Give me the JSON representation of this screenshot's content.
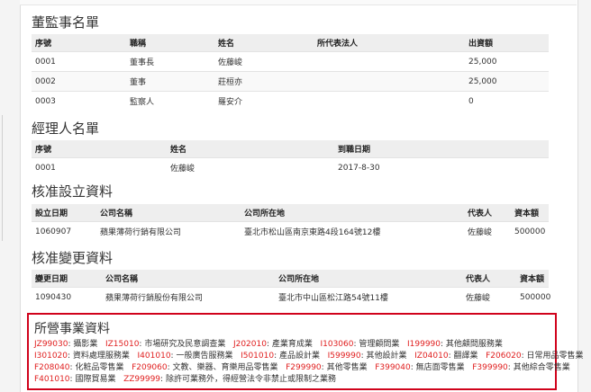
{
  "directors": {
    "title": "董監事名單",
    "headers": [
      "序號",
      "職稱",
      "姓名",
      "所代表法人",
      "出資額"
    ],
    "rows": [
      [
        "0001",
        "董事長",
        "佐藤峻",
        "",
        "25,000"
      ],
      [
        "0002",
        "董事",
        "莊桓亦",
        "",
        "25,000"
      ],
      [
        "0003",
        "監察人",
        "羅安介",
        "",
        "0"
      ]
    ]
  },
  "managers": {
    "title": "經理人名單",
    "headers": [
      "序號",
      "姓名",
      "到職日期"
    ],
    "rows": [
      [
        "0001",
        "佐藤峻",
        "2017-8-30"
      ]
    ]
  },
  "establish": {
    "title": "核准設立資料",
    "headers": [
      "設立日期",
      "公司名稱",
      "公司所在地",
      "代表人",
      "資本額"
    ],
    "rows": [
      [
        "1060907",
        "蘋果薄荷行銷有限公司",
        "臺北市松山區南京東路4段164號12樓",
        "佐藤峻",
        "500000"
      ]
    ]
  },
  "change": {
    "title": "核准變更資料",
    "headers": [
      "變更日期",
      "公司名稱",
      "公司所在地",
      "代表人",
      "資本額"
    ],
    "rows": [
      [
        "1090430",
        "蘋果薄荷行銷股份有限公司",
        "臺北市中山區松江路54號11樓",
        "佐藤峻",
        "500000"
      ]
    ]
  },
  "business": {
    "title": "所營事業資料",
    "highlight_color": "#d0021b",
    "code_color": "#e02020",
    "lines": [
      [
        {
          "code": "JZ99030",
          "desc": "攝影業"
        },
        {
          "code": "IZ15010",
          "desc": "市場研究及民意調查業"
        },
        {
          "code": "J202010",
          "desc": "產業育成業"
        },
        {
          "code": "I103060",
          "desc": "管理顧問業"
        },
        {
          "code": "I199990",
          "desc": "其他顧問服務業"
        }
      ],
      [
        {
          "code": "I301020",
          "desc": "資料處理服務業"
        },
        {
          "code": "I401010",
          "desc": "一般廣告服務業"
        },
        {
          "code": "I501010",
          "desc": "產品設計業"
        },
        {
          "code": "I599990",
          "desc": "其他設計業"
        },
        {
          "code": "IZ04010",
          "desc": "翻譯業"
        },
        {
          "code": "F206020",
          "desc": "日常用品零售業"
        }
      ],
      [
        {
          "code": "F208040",
          "desc": "化粧品零售業"
        },
        {
          "code": "F209060",
          "desc": "文教、樂器、育樂用品零售業"
        },
        {
          "code": "F299990",
          "desc": "其他零售業"
        },
        {
          "code": "F399040",
          "desc": "無店面零售業"
        },
        {
          "code": "F399990",
          "desc": "其他綜合零售業"
        }
      ],
      [
        {
          "code": "F401010",
          "desc": "國際貿易業"
        },
        {
          "code": "ZZ99999",
          "desc": "除許可業務外，得經營法令非禁止或限制之業務"
        }
      ]
    ]
  }
}
